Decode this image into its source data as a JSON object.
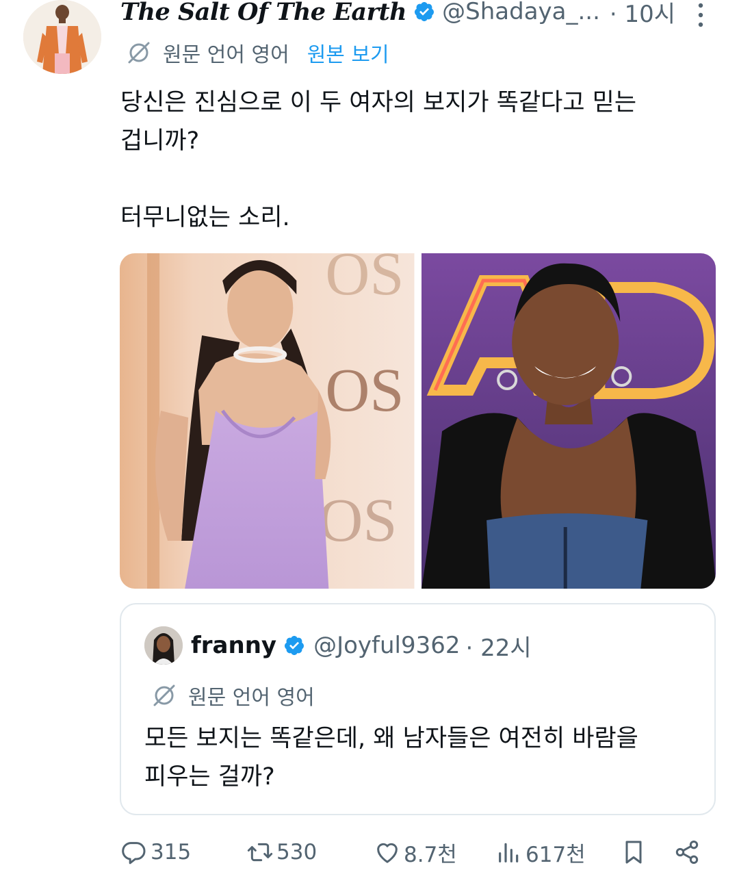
{
  "tweet": {
    "author": {
      "display_name": "The Salt Of The Earth",
      "handle": "@Shadaya_...",
      "time": "· 10시",
      "verified": true
    },
    "translation_note": "원문 언어 영어",
    "view_original": "원본 보기",
    "text": "당신은 진심으로 이 두 여자의 보지가 똑같다고 믿는\n겁니까?\n\n터무니없는 소리."
  },
  "quote": {
    "author": {
      "display_name": "franny",
      "handle": "@Joyful9362",
      "time": "· 22시",
      "verified": true
    },
    "translation_note": "원문 언어 영어",
    "text": "모든 보지는 똑같은데, 왜 남자들은 여전히 바람을\n피우는 걸까?"
  },
  "actions": {
    "replies": "315",
    "reposts": "530",
    "likes": "8.7천",
    "views": "617천"
  },
  "colors": {
    "text": "#0f1419",
    "secondary": "#536471",
    "link": "#1d9bf0",
    "verified": "#1d9bf0",
    "border": "#e1e8ed"
  },
  "icons": [
    "verified-badge-icon",
    "more-icon",
    "translate-icon",
    "reply-icon",
    "repost-icon",
    "like-icon",
    "views-icon",
    "bookmark-icon",
    "share-icon"
  ]
}
